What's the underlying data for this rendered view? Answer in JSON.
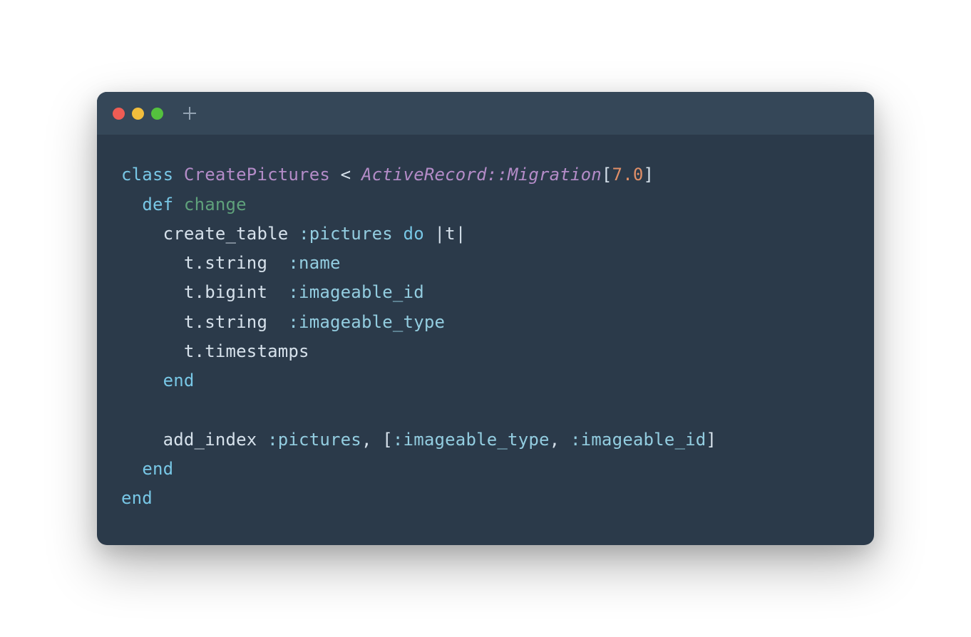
{
  "titlebar": {
    "traffic_lights": {
      "close": "close",
      "minimize": "minimize",
      "zoom": "zoom"
    },
    "new_tab": "+"
  },
  "code": {
    "line1": {
      "class_kw": "class",
      "class_name": "CreatePictures",
      "lt": " < ",
      "inherit": "ActiveRecord::Migration",
      "lbracket": "[",
      "version": "7.0",
      "rbracket": "]"
    },
    "line2": {
      "indent": "  ",
      "def_kw": "def",
      "method_name": "change"
    },
    "line3": {
      "indent": "    ",
      "fn": "create_table ",
      "sym": ":pictures",
      "do_kw": " do ",
      "block": "|t|"
    },
    "line4": {
      "indent": "      ",
      "call": "t.string  ",
      "sym": ":name"
    },
    "line5": {
      "indent": "      ",
      "call": "t.bigint  ",
      "sym": ":imageable_id"
    },
    "line6": {
      "indent": "      ",
      "call": "t.string  ",
      "sym": ":imageable_type"
    },
    "line7": {
      "indent": "      ",
      "call": "t.timestamps"
    },
    "line8": {
      "indent": "    ",
      "end_kw": "end"
    },
    "line9": {
      "blank": ""
    },
    "line10": {
      "indent": "    ",
      "fn": "add_index ",
      "sym1": ":pictures",
      "comma": ", [",
      "sym2": ":imageable_type",
      "comma2": ", ",
      "sym3": ":imageable_id",
      "close": "]"
    },
    "line11": {
      "indent": "  ",
      "end_kw": "end"
    },
    "line12": {
      "end_kw": "end"
    }
  }
}
